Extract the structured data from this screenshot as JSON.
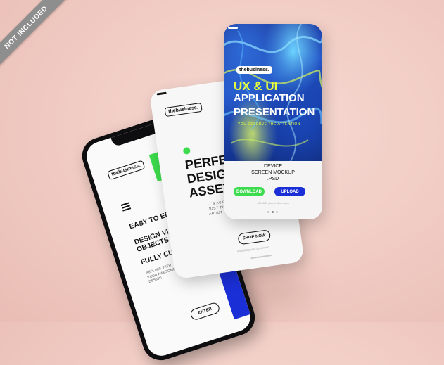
{
  "ribbon": {
    "text": "NOT INCLUDED"
  },
  "phone_screen": {
    "logo": "thebusiness.",
    "menu_items": [
      "EASY TO EDIT",
      "DESIGN VIA SMART OBJECTS",
      "FULLY CUSTOMIZ"
    ],
    "body_lines": [
      "REPLACE WITH",
      "YOUR AWESOME",
      "DESIGN"
    ],
    "enter_button": "ENTER"
  },
  "middle_card": {
    "logo": "thebusiness.",
    "headline": [
      "PERFECT",
      "DESIGNE",
      "ASSETS"
    ],
    "sub_lines": [
      "IT'S ASK YOUR",
      "JUST THINK A",
      "ABOUT"
    ],
    "shop_button": "SHOP NOW",
    "footer": "400x540 pixels dimension"
  },
  "front_card": {
    "logo": "thebusiness.",
    "headline_line1": "UX & UI",
    "headline_line2": "APPLICATION",
    "headline_line3": "PRESENTATION",
    "tagline": "YOU DESERVE THE ATTENTION",
    "device_line1": "DEVICE",
    "device_line2": "SCREEN MOCKUP",
    "device_line3": ".PSD",
    "download_button": "DOWNLOAD",
    "upload_button": "UPLOAD",
    "footer": "400x540 pixels dimension"
  },
  "colors": {
    "accent_green": "#3ddc4e",
    "accent_blue": "#1b2fd6",
    "headline_yellow": "#e8ff3a"
  }
}
